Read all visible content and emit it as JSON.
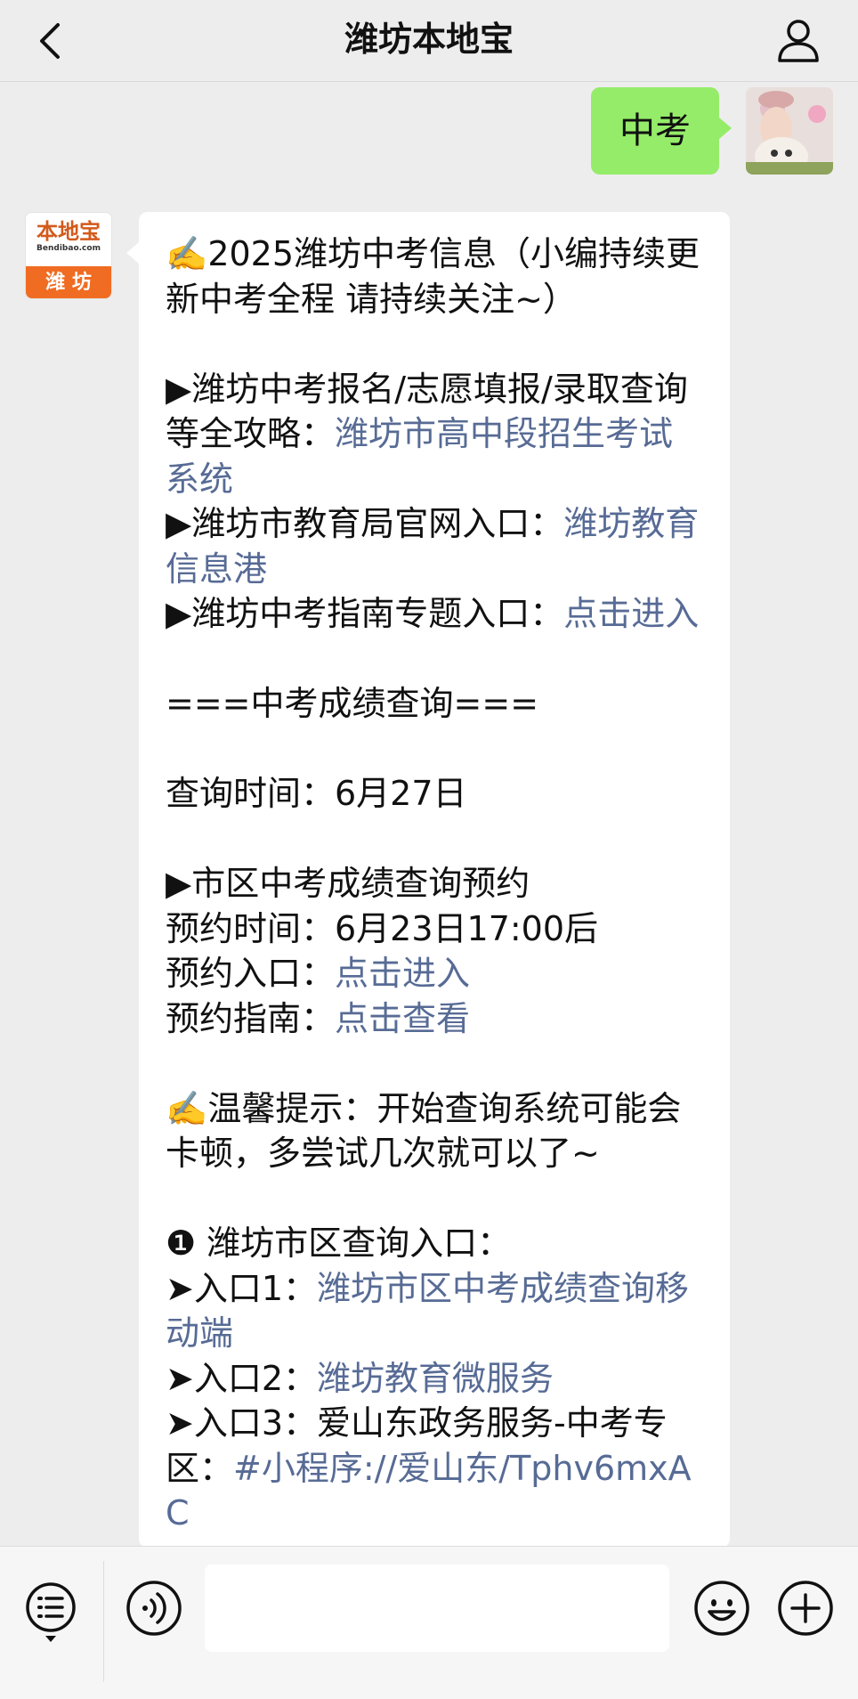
{
  "header": {
    "title": "潍坊本地宝",
    "back_icon": "chevron-left-icon",
    "profile_icon": "person-icon"
  },
  "user_message": {
    "text": "中考"
  },
  "logo": {
    "top_text": "本地宝",
    "sub_text": "Bendibao.com",
    "bottom_text": "潍 坊"
  },
  "message": {
    "line1": "✍️2025潍坊中考信息（小编持续更新中考全程 请持续关注~）",
    "item1_prefix": "▶潍坊中考报名/志愿填报/录取查询等全攻略：",
    "item1_link": "潍坊市高中段招生考试系统",
    "item2_prefix": "▶潍坊市教育局官网入口：",
    "item2_link": "潍坊教育信息港",
    "item3_prefix": "▶潍坊中考指南专题入口：",
    "item3_link": "点击进入",
    "section_title": "===中考成绩查询===",
    "query_time": "查询时间：6月27日",
    "reservation_title": "▶市区中考成绩查询预约",
    "reservation_time": "预约时间：6月23日17:00后",
    "reservation_entry_prefix": "预约入口：",
    "reservation_entry_link": "点击进入",
    "reservation_guide_prefix": "预约指南：",
    "reservation_guide_link": "点击查看",
    "tip": "✍️温馨提示：开始查询系统可能会卡顿，多尝试几次就可以了~",
    "city_title": "❶ 潍坊市区查询入口：",
    "entry1_prefix": "➤入口1：",
    "entry1_link": "潍坊市区中考成绩查询移动端",
    "entry2_prefix": "➤入口2：",
    "entry2_link": "潍坊教育微服务",
    "entry3_prefix": "➤入口3：爱山东政务服务-中考专区：",
    "entry3_link": "#小程序://爱山东/Tphv6mxAC"
  },
  "bottom_bar": {
    "input_value": "",
    "icons": [
      "menu-icon",
      "voice-icon",
      "emoji-icon",
      "plus-icon"
    ]
  },
  "colors": {
    "background": "#ededed",
    "user_bubble": "#95ec69",
    "link": "#576b95",
    "logo_orange": "#ef6c22"
  }
}
